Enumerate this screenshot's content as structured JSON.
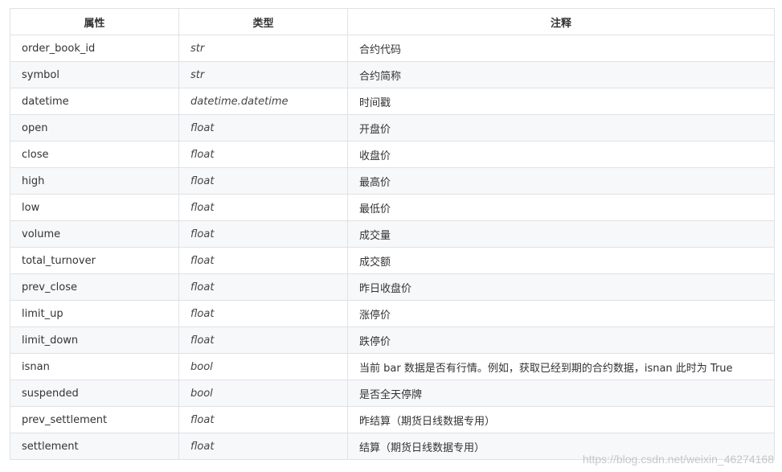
{
  "table": {
    "headers": [
      "属性",
      "类型",
      "注释"
    ],
    "rows": [
      {
        "attr": "order_book_id",
        "type": "str",
        "note": "合约代码"
      },
      {
        "attr": "symbol",
        "type": "str",
        "note": "合约简称"
      },
      {
        "attr": "datetime",
        "type": "datetime.datetime",
        "note": "时间戳"
      },
      {
        "attr": "open",
        "type": "float",
        "note": "开盘价"
      },
      {
        "attr": "close",
        "type": "float",
        "note": "收盘价"
      },
      {
        "attr": "high",
        "type": "float",
        "note": "最高价"
      },
      {
        "attr": "low",
        "type": "float",
        "note": "最低价"
      },
      {
        "attr": "volume",
        "type": "float",
        "note": "成交量"
      },
      {
        "attr": "total_turnover",
        "type": "float",
        "note": "成交额"
      },
      {
        "attr": "prev_close",
        "type": "float",
        "note": "昨日收盘价"
      },
      {
        "attr": "limit_up",
        "type": "float",
        "note": "涨停价"
      },
      {
        "attr": "limit_down",
        "type": "float",
        "note": "跌停价"
      },
      {
        "attr": "isnan",
        "type": "bool",
        "note": "当前 bar 数据是否有行情。例如，获取已经到期的合约数据，isnan 此时为 True"
      },
      {
        "attr": "suspended",
        "type": "bool",
        "note": "是否全天停牌"
      },
      {
        "attr": "prev_settlement",
        "type": "float",
        "note": "昨结算（期货日线数据专用）"
      },
      {
        "attr": "settlement",
        "type": "float",
        "note": "结算（期货日线数据专用）"
      }
    ]
  },
  "watermark": "https://blog.csdn.net/weixin_46274168",
  "colors": {
    "border": "#dfe2e5",
    "row_alt": "#f6f8fa",
    "text": "#333333"
  }
}
